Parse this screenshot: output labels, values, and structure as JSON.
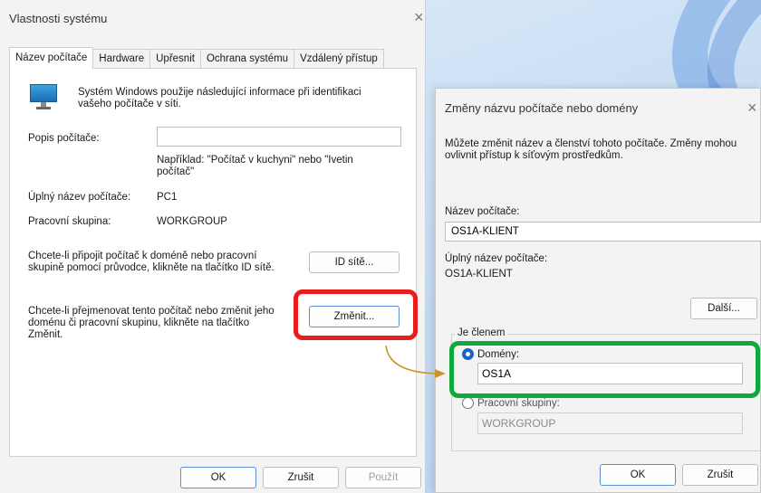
{
  "system_properties": {
    "title": "Vlastnosti systému",
    "close_glyph": "×",
    "tabs": [
      {
        "label": "Název počítače",
        "active": true
      },
      {
        "label": "Hardware",
        "active": false
      },
      {
        "label": "Upřesnit",
        "active": false
      },
      {
        "label": "Ochrana systému",
        "active": false
      },
      {
        "label": "Vzdálený přístup",
        "active": false
      }
    ],
    "intro_text": "Systém Windows použije následující informace při identifikaci vašeho počítače v síti.",
    "description_label": "Popis počítače:",
    "description_value": "",
    "example_text": "Například: \"Počítač v kuchyni\" nebo \"Ivetin počítač\"",
    "full_name_label": "Úplný název počítače:",
    "full_name_value": "PC1",
    "workgroup_label": "Pracovní skupina:",
    "workgroup_value": "WORKGROUP",
    "network_id_text": "Chcete-li připojit počítač k doméně nebo pracovní skupině pomocí průvodce, klikněte na tlačítko ID sítě.",
    "network_id_button": "ID sítě...",
    "rename_text": "Chcete-li přejmenovat tento počítač nebo změnit jeho doménu či pracovní skupinu, klikněte na tlačítko Změnit.",
    "change_button": "Změnit...",
    "ok_button": "OK",
    "cancel_button": "Zrušit",
    "apply_button": "Použít"
  },
  "name_changes": {
    "title": "Změny názvu počítače nebo domény",
    "close_glyph": "×",
    "intro_text": "Můžete změnit název a členství tohoto počítače. Změny mohou ovlivnit přístup k síťovým prostředkům.",
    "computer_name_label": "Název počítače:",
    "computer_name_value": "OS1A-KLIENT",
    "full_name_label": "Úplný název počítače:",
    "full_name_value": "OS1A-KLIENT",
    "more_button": "Další...",
    "member_of_label": "Je členem",
    "domain_label": "Domény:",
    "domain_value": "OS1A",
    "workgroup_label": "Pracovní skupiny:",
    "workgroup_value": "WORKGROUP",
    "member_of": "domain",
    "ok_button": "OK",
    "cancel_button": "Zrušit"
  },
  "colors": {
    "red_highlight": "#ea1c1c",
    "green_highlight": "#0fa83d",
    "arrow": "#c9952b",
    "accent": "#1a63c0"
  }
}
